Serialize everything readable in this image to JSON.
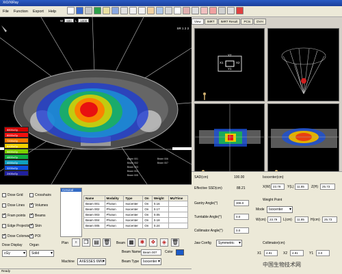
{
  "window": {
    "title": "XiO/XiRay"
  },
  "menu": {
    "items": [
      "File",
      "Function",
      "Export",
      "Help"
    ]
  },
  "viewer": {
    "w_label": "W",
    "w_value": "600",
    "l_label": "L",
    "l_value": "1000",
    "top_right": "SR  1 2 3",
    "legend": [
      {
        "label": "8800cGy",
        "color": "#d40000"
      },
      {
        "label": "8000cGy",
        "color": "#f01010"
      },
      {
        "label": "7200cGy",
        "color": "#ff7a00"
      },
      {
        "label": "6400cGy",
        "color": "#f0d000"
      },
      {
        "label": "5600cGy",
        "color": "#7cd000"
      },
      {
        "label": "4800cGy",
        "color": "#10b040"
      },
      {
        "label": "4000cGy",
        "color": "#10a0c0"
      },
      {
        "label": "3200cGy",
        "color": "#1050e0"
      },
      {
        "label": "2400cGy",
        "color": "#2020a0"
      }
    ],
    "beam_labels": [
      "Beam 001",
      "Beam 002",
      "Beam 003",
      "Beam 004",
      "Beam 005",
      "Beam 006",
      "Beam 007"
    ]
  },
  "right": {
    "tabs": [
      "View",
      "IMRT",
      "IMRT Result",
      "PCIs",
      "DVH"
    ],
    "bev_labels": {
      "y2": "Y2",
      "x1": "X1",
      "x2": "X2",
      "y1": "Y1"
    }
  },
  "controls": {
    "checkboxes": [
      {
        "label": "Dose Grid",
        "checked": false
      },
      {
        "label": "Dose Lines",
        "checked": false
      },
      {
        "label": "Fram points",
        "checked": true
      },
      {
        "label": "Edge Projection",
        "checked": false
      },
      {
        "label": "Dose Colorwash",
        "checked": true
      },
      {
        "label": "Crosshairs",
        "checked": false
      },
      {
        "label": "Volumes",
        "checked": true
      },
      {
        "label": "Beams",
        "checked": true
      },
      {
        "label": "Skin",
        "checked": true
      },
      {
        "label": "POI",
        "checked": true
      }
    ],
    "dose_display_label": "Dose Display",
    "organ_label": "Organ",
    "unit_value": "cGy",
    "solid_value": "Solid",
    "plan_item": "Cervical",
    "plan_label": "Plan",
    "beam_label": "Beam",
    "beam_name_label": "Beam Name",
    "beam_name_value": "Beam 007",
    "beam_type_label": "Beam Type",
    "beam_type_value": "Isocenter",
    "color_label": "Color",
    "machine_label": "Machine",
    "machine_value": "AXESSES 6MV"
  },
  "beam_table": {
    "headers": [
      "Name",
      "Modality",
      "Type",
      "On",
      "Weight",
      "MU/Time"
    ],
    "rows": [
      [
        "Beam 001",
        "Photon",
        "Isocenter",
        "On",
        "0.16",
        ""
      ],
      [
        "Beam 002",
        "Photon",
        "Isocenter",
        "On",
        "0.17",
        ""
      ],
      [
        "Beam 003",
        "Photon",
        "Isocenter",
        "On",
        "0.05",
        ""
      ],
      [
        "Beam 004",
        "Photon",
        "Isocenter",
        "On",
        "0.18",
        ""
      ],
      [
        "Beam 005",
        "Photon",
        "Isocenter",
        "On",
        "0.24",
        ""
      ]
    ]
  },
  "props": {
    "sad_label": "SAD(cm)",
    "sad_value": "100.00",
    "ssd_label": "Effective SSD(cm)",
    "ssd_value": "88.21",
    "gantry_label": "Gantry Angle(°)",
    "gantry_value": "308.0",
    "turntable_label": "Turntable Angle(°)",
    "turntable_value": "0.0",
    "collimator_angle_label": "Collimator Angle(°)",
    "collimator_angle_value": "0.0",
    "jaw_label": "Jaw Config",
    "jaw_value": "Symmetric",
    "isocenter_label": "Isocenter(cm)",
    "x_label": "X(W)",
    "x_value": "23.79",
    "y_label": "Y(L)",
    "y_value": "11.85",
    "z_label": "Z(H)",
    "z_value": "25.73",
    "weight_label": "Weight Point",
    "mode_label": "Mode",
    "mode_value": "Isocenter",
    "w_label": "W(cm)",
    "w_value": "23.79",
    "l_label": "L(cm)",
    "l_value": "11.85",
    "h_label": "H(cm)",
    "h_value": "25.73",
    "collimator_label": "Collimator(cm)",
    "c_x1_label": "X1",
    "c_x1_value": "4.91",
    "c_x2_label": "X2",
    "c_x2_value": "4.91",
    "c_y1_label": "Y1",
    "c_y1_value": "3.0"
  },
  "status": {
    "text": "Ready"
  },
  "watermark": {
    "text": "中国生物技术网"
  }
}
